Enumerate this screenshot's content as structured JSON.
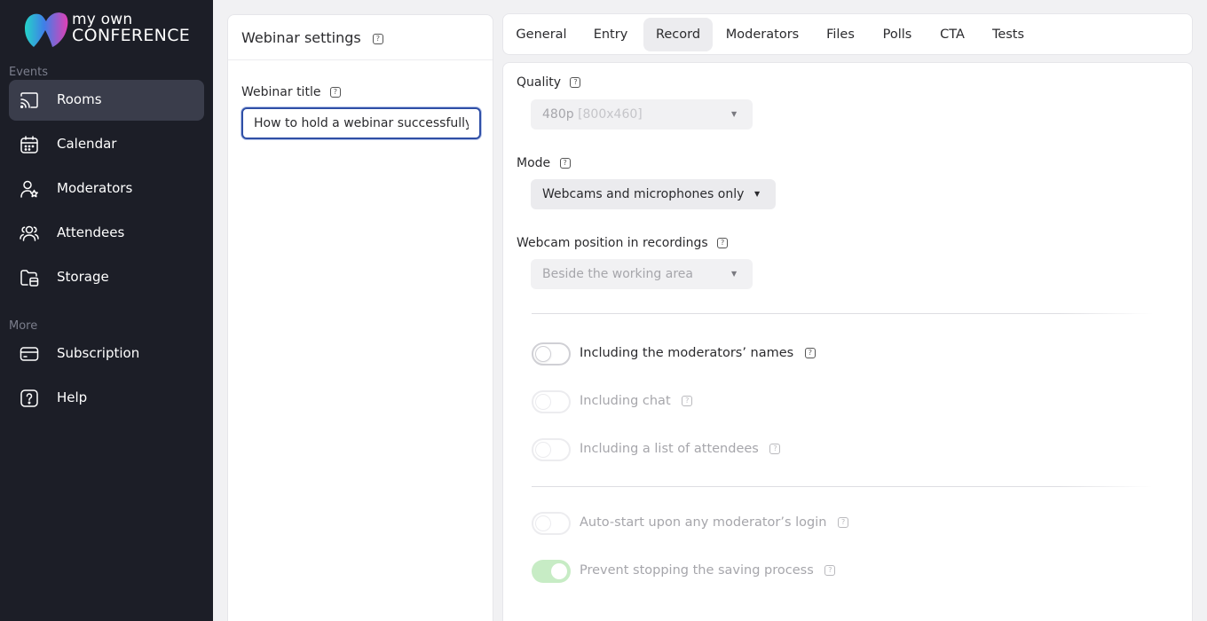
{
  "brand": {
    "line1": "my own",
    "line2": "CONFERENCE"
  },
  "sidebar": {
    "sections": [
      {
        "label": "Events",
        "items": [
          {
            "label": "Rooms",
            "icon": "cast-icon",
            "active": true
          },
          {
            "label": "Calendar",
            "icon": "calendar-icon",
            "active": false
          },
          {
            "label": "Moderators",
            "icon": "moderator-icon",
            "active": false
          },
          {
            "label": "Attendees",
            "icon": "attendees-icon",
            "active": false
          },
          {
            "label": "Storage",
            "icon": "folder-icon",
            "active": false
          }
        ]
      },
      {
        "label": "More",
        "items": [
          {
            "label": "Subscription",
            "icon": "card-icon",
            "active": false
          },
          {
            "label": "Help",
            "icon": "help-icon",
            "active": false
          }
        ]
      }
    ]
  },
  "left_panel": {
    "title": "Webinar settings",
    "webinar_title_label": "Webinar title",
    "webinar_title_value": "How to hold a webinar successfully"
  },
  "tabs": [
    "General",
    "Entry",
    "Record",
    "Moderators",
    "Files",
    "Polls",
    "CTA",
    "Tests"
  ],
  "active_tab": "Record",
  "record": {
    "quality": {
      "label": "Quality",
      "value": "480p",
      "suffix": "[800x460]",
      "disabled": true
    },
    "mode": {
      "label": "Mode",
      "value": "Webcams and microphones only",
      "disabled": false
    },
    "webcam_position": {
      "label": "Webcam position in recordings",
      "value": "Beside the working area",
      "disabled": true
    },
    "toggles_group1": [
      {
        "label": "Including the moderators’ names",
        "on": false,
        "disabled": false
      },
      {
        "label": "Including chat",
        "on": false,
        "disabled": true
      },
      {
        "label": "Including a list of attendees",
        "on": false,
        "disabled": true
      }
    ],
    "toggles_group2": [
      {
        "label": "Auto-start upon any moderator’s login",
        "on": false,
        "disabled": true
      },
      {
        "label": "Prevent stopping the saving process",
        "on": true,
        "disabled": true
      }
    ]
  },
  "colors": {
    "sidebar_bg": "#1c1e27",
    "sidebar_active": "#3a3d4b",
    "input_focus": "#2f4fa6",
    "toggle_on_faded": "#c7ecc5"
  }
}
